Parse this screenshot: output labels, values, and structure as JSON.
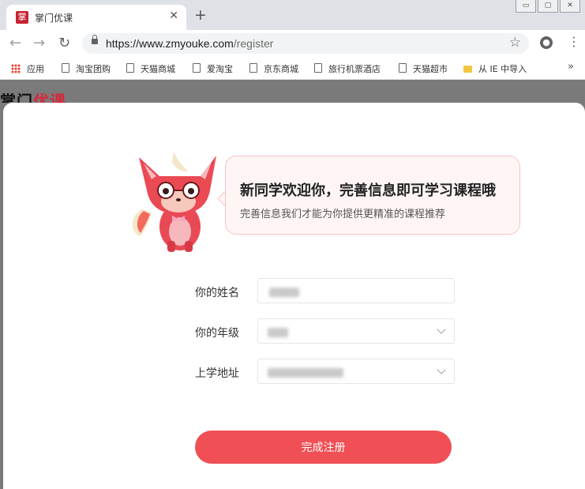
{
  "browser": {
    "tab_favicon": "掌",
    "tab_title": "掌门优课",
    "tab_close": "✕",
    "new_tab": "+",
    "window_controls": [
      "▭",
      "▢",
      "✕"
    ],
    "back": "←",
    "forward": "→",
    "reload": "↻",
    "url_host": "https://www.zmyouke.com",
    "url_path": "/register",
    "star": "☆",
    "menu": "⋮",
    "bookmarks": [
      {
        "label": "应用",
        "icon": "apps-icon"
      },
      {
        "label": "淘宝团购",
        "icon": "page-icon"
      },
      {
        "label": "天猫商城",
        "icon": "page-icon"
      },
      {
        "label": "爱淘宝",
        "icon": "page-icon"
      },
      {
        "label": "京东商城",
        "icon": "page-icon"
      },
      {
        "label": "旅行机票酒店",
        "icon": "page-icon"
      },
      {
        "label": "天猫超市",
        "icon": "page-icon"
      },
      {
        "label": "从 IE 中导入",
        "icon": "folder-icon"
      }
    ],
    "bookmarks_more": "»"
  },
  "page": {
    "logo_part1": "掌门",
    "logo_part2": "优课",
    "bubble_title": "新同学欢迎你，完善信息即可学习课程哦",
    "bubble_subtitle": "完善信息我们才能为你提供更精准的课程推荐",
    "form": {
      "name_label": "你的姓名",
      "grade_label": "你的年级",
      "school_label": "上学地址"
    },
    "submit_label": "完成注册"
  },
  "colors": {
    "brand_red": "#ef4f55",
    "overlay": "#7a7a7a"
  }
}
